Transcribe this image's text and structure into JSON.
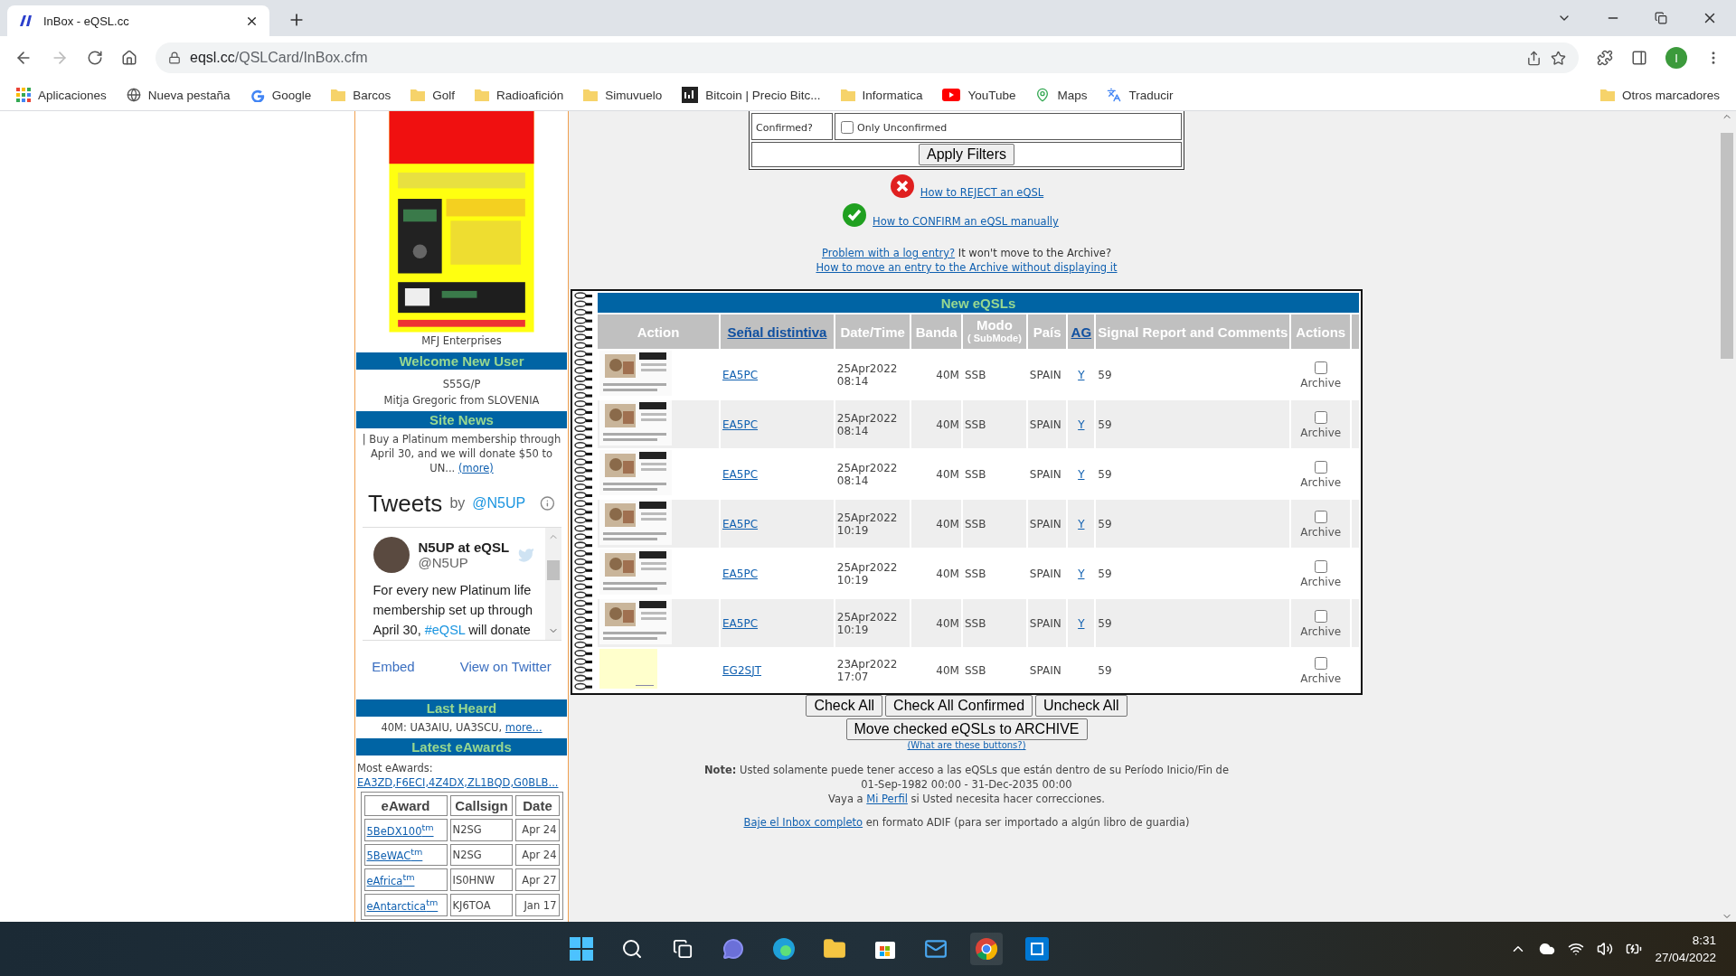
{
  "browser": {
    "tab_title": "InBox - eQSL.cc",
    "url_host": "eqsl.cc",
    "url_path": "/QSLCard/InBox.cfm",
    "profile_initial": "I",
    "bookmarks": [
      {
        "kind": "apps",
        "label": "Aplicaciones"
      },
      {
        "kind": "site",
        "label": "Nueva pestaña"
      },
      {
        "kind": "google",
        "label": "Google"
      },
      {
        "kind": "folder",
        "label": "Barcos"
      },
      {
        "kind": "folder",
        "label": "Golf"
      },
      {
        "kind": "folder",
        "label": "Radioafición"
      },
      {
        "kind": "folder",
        "label": "Simuvuelo"
      },
      {
        "kind": "investing",
        "label": "Bitcoin | Precio Bitc..."
      },
      {
        "kind": "folder",
        "label": "Informatica"
      },
      {
        "kind": "video",
        "label": "YouTube"
      },
      {
        "kind": "maps",
        "label": "Maps"
      },
      {
        "kind": "translate",
        "label": "Traducir"
      }
    ],
    "other_bookmarks": "Otros marcadores"
  },
  "sidebar": {
    "ad": {
      "kind": "picture",
      "caption": "MFJ Enterprises"
    },
    "welcome": {
      "title": "Welcome New User",
      "callsign": "S55G/P",
      "name": "Mitja Gregoric from SLOVENIA"
    },
    "site_news": {
      "title": "Site News",
      "text": "| Buy a Platinum membership through April 30, and we will donate $50 to UN...",
      "more": "(more)"
    },
    "tweets": {
      "title": "Tweets",
      "by": "by",
      "handle_link": "@N5UP",
      "account": "N5UP at eQSL",
      "handle": "@N5UP",
      "text_before": "For every new Platinum life membership set up through April 30, ",
      "hashtag": "#eQSL",
      "text_after": " will donate",
      "embed": "Embed",
      "view": "View on Twitter"
    },
    "last_heard": {
      "title": "Last Heard",
      "text": "40M: UA3AIU, UA3SCU, ",
      "more": "more..."
    },
    "eawards": {
      "title": "Latest eAwards",
      "label": "Most eAwards:",
      "list": "EA3ZD,F6ECI,4Z4DX,ZL1BQD,G0BLB...",
      "columns": [
        "eAward",
        "Callsign",
        "Date"
      ],
      "rows": [
        {
          "award": "5BeDX100$^{tm}$",
          "callsign": "N2SG",
          "date": "Apr 24"
        },
        {
          "award": "5BeWAC$^{tm}$",
          "callsign": "N2SG",
          "date": "Apr 24"
        },
        {
          "award": "eAfrica$^{tm}$",
          "callsign": "IS0HNW",
          "date": "Apr 27"
        },
        {
          "award": "eAntarctica$^{tm}$",
          "callsign": "KJ6TOA",
          "date": "Jan 17"
        }
      ]
    }
  },
  "filters": {
    "confirmed_label": "Confirmed?",
    "only_unconfirmed": {
      "label": "Only Unconfirmed",
      "checked": false
    },
    "apply": "Apply Filters"
  },
  "help": {
    "reject": "How to REJECT an eQSL",
    "confirm": "How to CONFIRM an eQSL manually",
    "problem_link": "Problem with a log entry?",
    "problem_text": " It won't move to the Archive?",
    "archive_link": "How to move an entry to the Archive without displaying it"
  },
  "table": {
    "title": "New eQSLs",
    "columns": [
      {
        "label": "Action",
        "link": false
      },
      {
        "label": "Señal distintiva",
        "link": true
      },
      {
        "label": "Date/Time",
        "link": false
      },
      {
        "label": "Banda",
        "link": false
      },
      {
        "label": "Modo",
        "sub": "( SubMode)",
        "link": false
      },
      {
        "label": "País",
        "link": false
      },
      {
        "label": "AG",
        "link": true
      },
      {
        "label": "Signal Report and Comments",
        "link": false
      },
      {
        "label": "Actions",
        "link": false
      }
    ],
    "rows": [
      {
        "kind": "picture",
        "callsign": "EA5PC",
        "date": "25Apr2022",
        "time": "08:14",
        "band": "40M",
        "mode": "SSB",
        "country": "SPAIN",
        "ag": "Y",
        "report": "59",
        "archive": "Archive",
        "checked": false
      },
      {
        "kind": "picture",
        "callsign": "EA5PC",
        "date": "25Apr2022",
        "time": "08:14",
        "band": "40M",
        "mode": "SSB",
        "country": "SPAIN",
        "ag": "Y",
        "report": "59",
        "archive": "Archive",
        "checked": false
      },
      {
        "kind": "picture",
        "callsign": "EA5PC",
        "date": "25Apr2022",
        "time": "08:14",
        "band": "40M",
        "mode": "SSB",
        "country": "SPAIN",
        "ag": "Y",
        "report": "59",
        "archive": "Archive",
        "checked": false
      },
      {
        "kind": "picture",
        "callsign": "EA5PC",
        "date": "25Apr2022",
        "time": "10:19",
        "band": "40M",
        "mode": "SSB",
        "country": "SPAIN",
        "ag": "Y",
        "report": "59",
        "archive": "Archive",
        "checked": false
      },
      {
        "kind": "picture",
        "callsign": "EA5PC",
        "date": "25Apr2022",
        "time": "10:19",
        "band": "40M",
        "mode": "SSB",
        "country": "SPAIN",
        "ag": "Y",
        "report": "59",
        "archive": "Archive",
        "checked": false
      },
      {
        "kind": "picture",
        "callsign": "EA5PC",
        "date": "25Apr2022",
        "time": "10:19",
        "band": "40M",
        "mode": "SSB",
        "country": "SPAIN",
        "ag": "Y",
        "report": "59",
        "archive": "Archive",
        "checked": false
      },
      {
        "kind": "blank",
        "callsign": "EG2SJT",
        "date": "23Apr2022",
        "time": "17:07",
        "band": "40M",
        "mode": "SSB",
        "country": "SPAIN",
        "report": "59",
        "archive": "Archive",
        "checked": false
      }
    ]
  },
  "buttons": {
    "row": [
      "Check All",
      "Check All Confirmed",
      "Uncheck All"
    ],
    "move": "Move checked eQSLs to ARCHIVE",
    "what": "(What are these buttons?)"
  },
  "note": {
    "label": "Note:",
    "line1": " Usted solamente puede tener acceso a las eQSLs que están dentro de su Período Inicio/Fin de",
    "line2": "01-Sep-1982 00:00 - 31-Dec-2035 00:00",
    "line3_before": "Vaya a ",
    "profile_link": "Mi Perfil",
    "line3_after": " si Usted necesita hacer correcciones."
  },
  "download": {
    "link": "Baje el Inbox completo",
    "text": " en formato ADIF (para ser importado a algún libro de guardia)"
  },
  "taskbar": {
    "time": "8:31",
    "date": "27/04/2022"
  }
}
